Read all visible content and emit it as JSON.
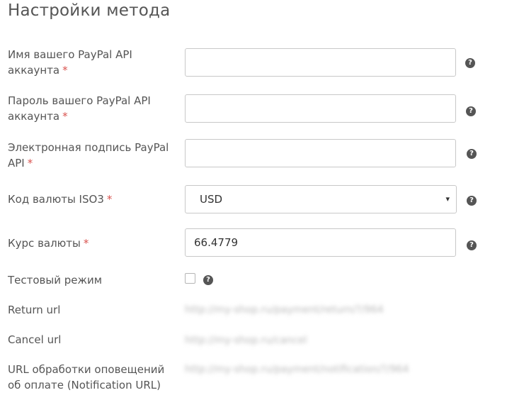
{
  "title": "Настройки метода",
  "form": {
    "api_username": {
      "label": "Имя вашего PayPal API аккаунта",
      "required": "*",
      "value": ""
    },
    "api_password": {
      "label": "Пароль вашего PayPal API аккаунта",
      "required": "*",
      "value": ""
    },
    "api_signature": {
      "label": "Электронная подпись PayPal API",
      "required": "*",
      "value": ""
    },
    "currency_code": {
      "label": "Код валюты ISO3",
      "required": "*",
      "value": "USD",
      "arrow": "▾"
    },
    "currency_rate": {
      "label": "Курс валюты",
      "required": "*",
      "value": "66.4779"
    },
    "test_mode": {
      "label": "Тестовый режим",
      "checked": false
    },
    "return_url": {
      "label": "Return url",
      "value": "http://my-shop.ru/payment/return/?/964"
    },
    "cancel_url": {
      "label": "Cancel url",
      "value": "http://my-shop.ru/cancel"
    },
    "notification_url": {
      "label": "URL обработки оповещений об оплате (Notification URL)",
      "value": "http://my-shop.ru/payment/notification/?/964"
    }
  },
  "help_glyph": "?",
  "colors": {
    "required": "#d9534f",
    "help_icon": "#555555",
    "text": "#555555"
  }
}
